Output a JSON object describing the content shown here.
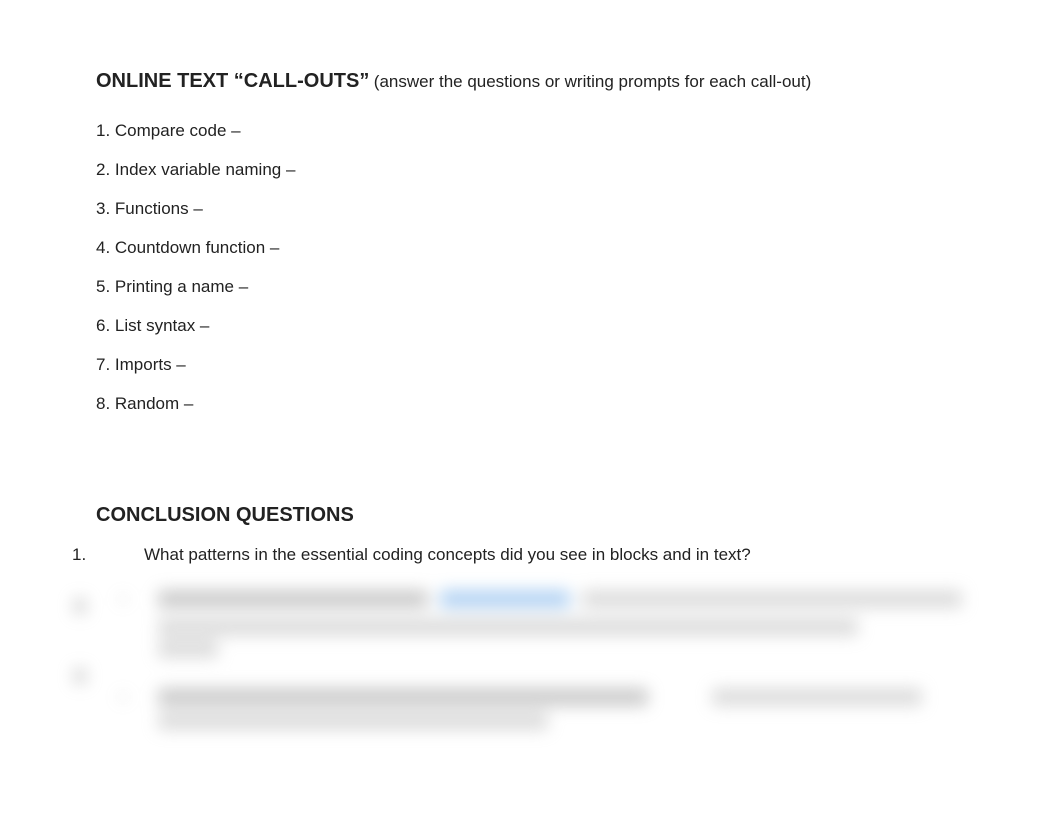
{
  "header": {
    "title": "ONLINE TEXT “CALL-OUTS”",
    "subtitle": " (answer the questions or writing prompts for each call-out)"
  },
  "callouts": [
    "1. Compare code –",
    "2. Index variable naming –",
    "3. Functions –",
    "4. Countdown function –",
    "5. Printing a name –",
    "6. List syntax –",
    "7. Imports –",
    "8. Random –"
  ],
  "conclusion": {
    "title": "CONCLUSION QUESTIONS",
    "items": [
      {
        "number": "1.",
        "text": "What patterns in the essential coding concepts did you see in blocks and in text?"
      }
    ]
  }
}
